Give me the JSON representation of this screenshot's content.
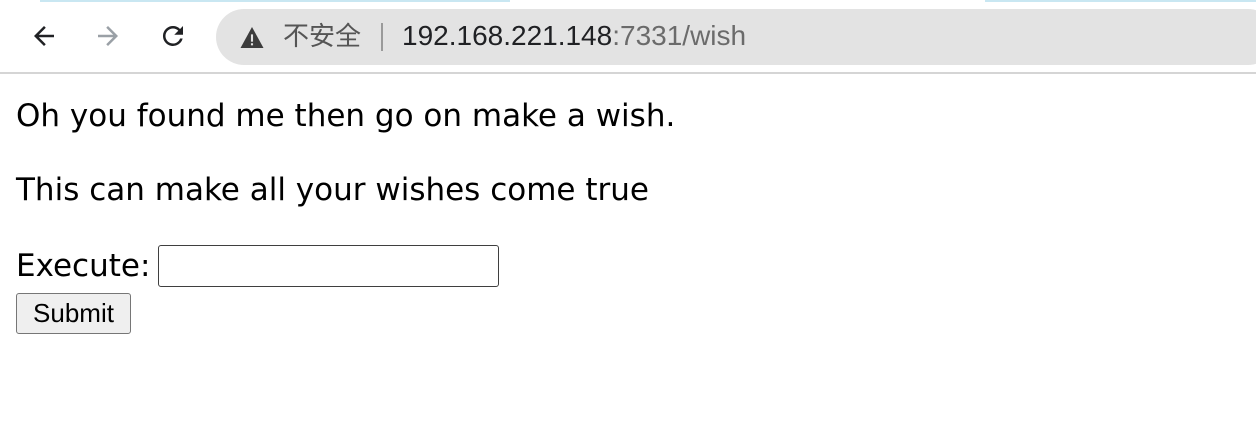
{
  "browser": {
    "back_icon": "arrow-left-icon",
    "forward_icon": "arrow-right-icon",
    "reload_icon": "reload-icon",
    "warning_icon": "warning-triangle-icon",
    "security_label": "不安全",
    "url_host": "192.168.221.148",
    "url_rest": ":7331/wish",
    "colors": {
      "omnibox_bg": "#e3e3e3",
      "url_host": "#202124",
      "url_rest": "#6b6b6b"
    }
  },
  "page": {
    "line1": "Oh you found me then go on make a wish.",
    "line2": "This can make all your wishes come true",
    "form": {
      "execute_label": "Execute:",
      "execute_value": "",
      "submit_label": "Submit"
    }
  }
}
